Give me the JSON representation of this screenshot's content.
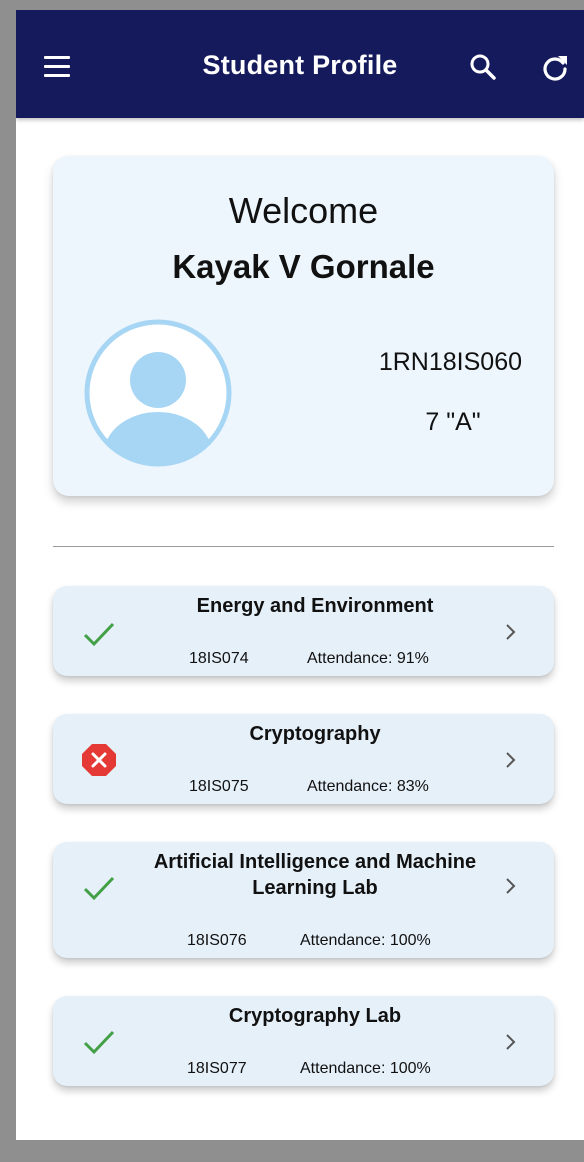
{
  "appbar": {
    "title": "Student Profile",
    "menu_icon": "hamburger-menu-icon",
    "search_icon": "search-icon",
    "refresh_icon": "refresh-icon",
    "background_color": "#151a5c"
  },
  "profile": {
    "greeting": "Welcome",
    "name": "Kayak V Gornale",
    "usn": "1RN18IS060",
    "section": "7  \"A\"",
    "avatar_icon": "user-avatar-icon"
  },
  "courses": [
    {
      "name": "Energy and Environment",
      "code": "18IS074",
      "attendance": "Attendance: 91%",
      "status": "ok"
    },
    {
      "name": "Cryptography",
      "code": "18IS075",
      "attendance": "Attendance: 83%",
      "status": "warning"
    },
    {
      "name": "Artificial Intelligence and Machine Learning Lab",
      "code": "18IS076",
      "attendance": "Attendance: 100%",
      "status": "ok"
    },
    {
      "name": "Cryptography Lab",
      "code": "18IS077",
      "attendance": "Attendance: 100%",
      "status": "ok"
    }
  ],
  "colors": {
    "ok": "#43a047",
    "warning": "#e53935",
    "card": "#e6f0f9",
    "avatar": "#a7d6f5"
  }
}
